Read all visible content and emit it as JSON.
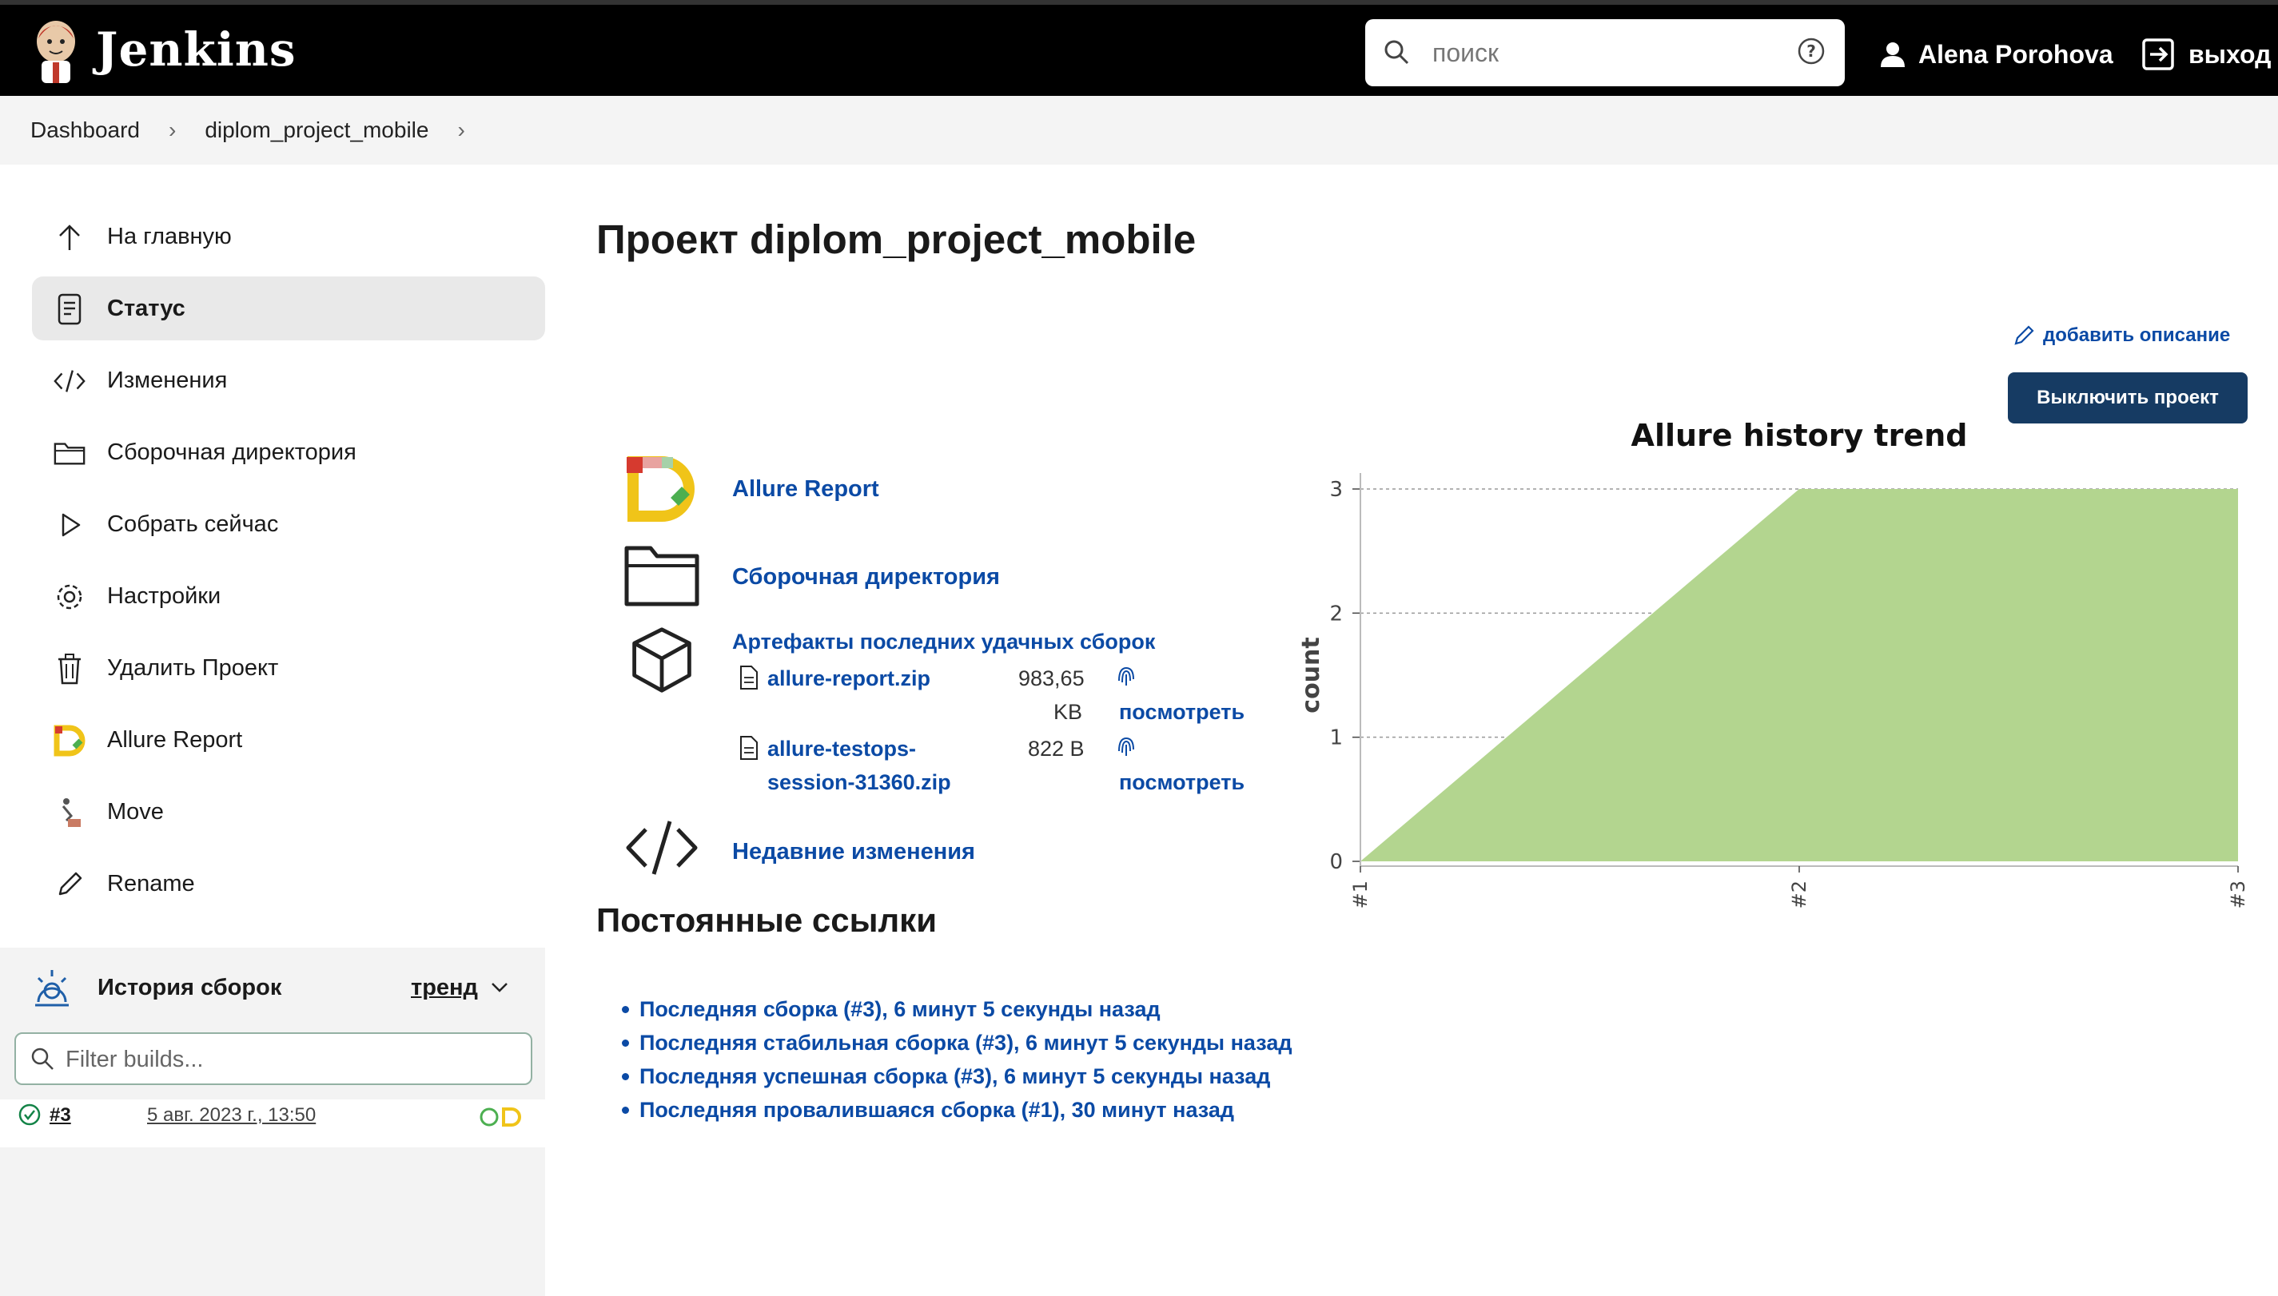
{
  "header": {
    "brand": "Jenkins",
    "search_placeholder": "поиск",
    "user_name": "Alena Porohova",
    "logout_label": "выход"
  },
  "breadcrumb": {
    "items": [
      "Dashboard",
      "diplom_project_mobile"
    ]
  },
  "sidebar": {
    "items": [
      {
        "label": "На главную",
        "icon": "arrow-up-icon"
      },
      {
        "label": "Статус",
        "icon": "document-icon",
        "active": true
      },
      {
        "label": "Изменения",
        "icon": "code-icon"
      },
      {
        "label": "Сборочная директория",
        "icon": "folder-icon"
      },
      {
        "label": "Собрать сейчас",
        "icon": "play-icon"
      },
      {
        "label": "Настройки",
        "icon": "gear-icon"
      },
      {
        "label": "Удалить Проект",
        "icon": "trash-icon"
      },
      {
        "label": "Allure Report",
        "icon": "allure-icon"
      },
      {
        "label": "Move",
        "icon": "move-icon"
      },
      {
        "label": "Rename",
        "icon": "pencil-icon"
      }
    ],
    "history": {
      "title": "История сборок",
      "trend_label": "тренд",
      "filter_placeholder": "Filter builds...",
      "build": {
        "number": "#3",
        "date": "5 авг. 2023 г., 13:50"
      }
    }
  },
  "main": {
    "title": "Проект diplom_project_mobile",
    "add_description": "добавить описание",
    "disable_button": "Выключить проект",
    "entries": {
      "allure_report": "Allure Report",
      "workspace": "Сборочная директория",
      "artifacts_title": "Артефакты последних удачных сборок",
      "recent_changes": "Недавние изменения"
    },
    "artifacts": [
      {
        "name_line1": "allure-report.zip",
        "name_line2": "",
        "size_line1": "983,65",
        "size_line2": "KB",
        "view": "посмотреть"
      },
      {
        "name_line1": "allure-testops-",
        "name_line2": "session-31360.zip",
        "size_line1": "822 B",
        "size_line2": "",
        "view": "посмотреть"
      }
    ],
    "permalinks_title": "Постоянные ссылки",
    "permalinks": [
      "Последняя сборка (#3), 6 минут 5 секунды назад",
      "Последняя стабильная сборка (#3), 6 минут 5 секунды назад",
      "Последняя успешная сборка (#3), 6 минут 5 секунды назад",
      "Последняя провалившаяся сборка (#1), 30 минут назад"
    ]
  },
  "chart_data": {
    "type": "area",
    "title": "Allure history trend",
    "xlabel": "",
    "ylabel": "count",
    "categories": [
      "#1",
      "#2",
      "#3"
    ],
    "series": [
      {
        "values": [
          0,
          3,
          3
        ],
        "color": "#b3d58f"
      }
    ],
    "ylim": [
      0,
      3
    ],
    "yticks": [
      0,
      1,
      2,
      3
    ],
    "grid": true
  },
  "colors": {
    "link": "#0b4aa5",
    "button": "#163b63",
    "area": "#b3d58f"
  }
}
